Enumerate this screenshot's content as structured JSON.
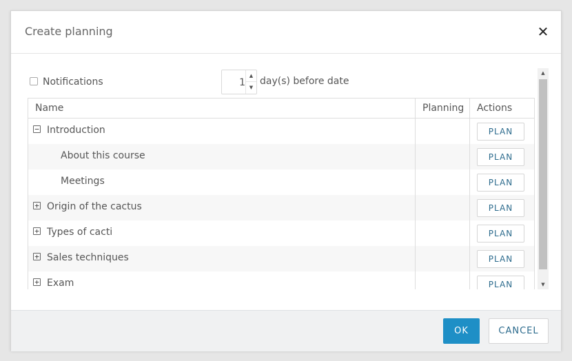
{
  "dialog": {
    "title": "Create planning",
    "close_glyph": "✕"
  },
  "notifications": {
    "label": "Notifications",
    "checked": false,
    "days_value": "1",
    "days_label": "day(s) before date"
  },
  "table": {
    "columns": [
      "Name",
      "Planning",
      "Actions"
    ],
    "rows": [
      {
        "name": "Introduction",
        "level": 0,
        "expander": "−",
        "planning": "",
        "action": "PLAN"
      },
      {
        "name": "About this course",
        "level": 1,
        "expander": "",
        "planning": "",
        "action": "PLAN"
      },
      {
        "name": "Meetings",
        "level": 1,
        "expander": "",
        "planning": "",
        "action": "PLAN"
      },
      {
        "name": "Origin of the cactus",
        "level": 0,
        "expander": "+",
        "planning": "",
        "action": "PLAN"
      },
      {
        "name": "Types of cacti",
        "level": 0,
        "expander": "+",
        "planning": "",
        "action": "PLAN"
      },
      {
        "name": "Sales techniques",
        "level": 0,
        "expander": "+",
        "planning": "",
        "action": "PLAN"
      },
      {
        "name": "Exam",
        "level": 0,
        "expander": "+",
        "planning": "",
        "action": "PLAN"
      }
    ]
  },
  "footer": {
    "ok_label": "OK",
    "cancel_label": "CANCEL"
  },
  "colors": {
    "primary": "#1e8fc6",
    "link_text": "#2b6a8c",
    "footer_bg": "#f0f1f2"
  },
  "icons": {
    "expand": "plus-square-icon",
    "collapse": "minus-square-icon",
    "close": "close-icon"
  }
}
